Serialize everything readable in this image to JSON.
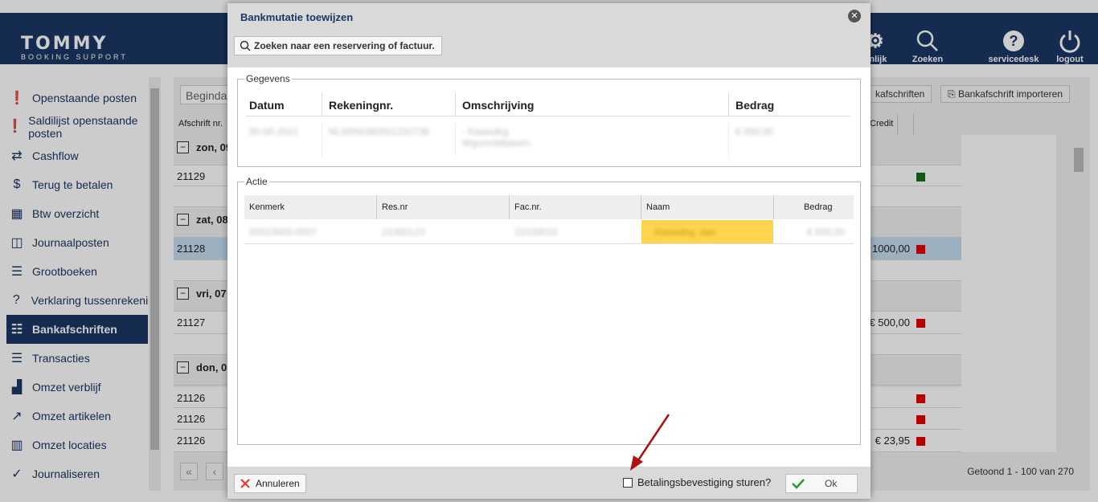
{
  "header": {
    "logo_main": "TOMMY",
    "logo_sub": "BOOKING SUPPORT",
    "buttons": [
      {
        "label": "onlijk",
        "icon": "gear-icon"
      },
      {
        "label": "Zoeken",
        "icon": "search-icon"
      },
      {
        "label": "servicedesk",
        "icon": "help-icon"
      },
      {
        "label": "logout",
        "icon": "power-icon"
      }
    ]
  },
  "sidebar": {
    "items": [
      {
        "label": "Openstaande posten"
      },
      {
        "label": "Saldilijst openstaande posten"
      },
      {
        "label": "Cashflow"
      },
      {
        "label": "Terug te betalen"
      },
      {
        "label": "Btw overzicht"
      },
      {
        "label": "Journaalposten"
      },
      {
        "label": "Grootboeken"
      },
      {
        "label": "Verklaring tussenrekenin"
      },
      {
        "label": "Bankafschriften"
      },
      {
        "label": "Transacties"
      },
      {
        "label": "Omzet verblijf"
      },
      {
        "label": "Omzet artikelen"
      },
      {
        "label": "Omzet locaties"
      },
      {
        "label": "Journaliseren"
      }
    ],
    "active": "Bankafschriften"
  },
  "main": {
    "begindatum_placeholder": "Begindat",
    "btn_bankafschriften": "kafschriften",
    "btn_import": "Bankafschrift importeren",
    "col_afschrift": "Afschrift nr.",
    "col_credit": "Credit",
    "groups": [
      {
        "label": "zon, 09",
        "rows": [
          {
            "nr": "21129",
            "credit": "",
            "status": "green"
          }
        ]
      },
      {
        "label": "zat, 08",
        "rows": [
          {
            "nr": "21128",
            "credit": "1000,00",
            "status": "red"
          }
        ]
      },
      {
        "label": "vri, 07",
        "rows": [
          {
            "nr": "21127",
            "credit": "€ 500,00",
            "status": "red"
          }
        ]
      },
      {
        "label": "don, 0",
        "rows": [
          {
            "nr": "21126",
            "credit": "",
            "status": "red"
          },
          {
            "nr": "21126",
            "credit": "",
            "status": "red"
          },
          {
            "nr": "21126",
            "credit": "€ 23,95",
            "status": "red"
          }
        ]
      }
    ],
    "pager_first": "«",
    "pager_prev": "‹",
    "getoond": "Getoond 1 - 100 van 270"
  },
  "modal": {
    "title": "Bankmutatie toewijzen",
    "search_label": "Zoeken naar een reservering of factuur.",
    "gegevens": {
      "legend": "Gegevens",
      "headers": [
        "Datum",
        "Rekeningnr.",
        "Omschrijving",
        "Bedrag"
      ],
      "row": [
        "00-00-2021",
        "NL00INGB0001232736",
        "- Klaasdhg Wgcmcblitaiven",
        "€ 000,00"
      ]
    },
    "actie": {
      "legend": "Actie",
      "headers": [
        "Kenmerk",
        "Res.nr",
        "Fac.nr.",
        "Naam",
        "Bedrag"
      ],
      "row": [
        "00010000-0007",
        "21000123",
        "22100010",
        "Klaasdhg, dan",
        "€ 000,00"
      ]
    },
    "cancel_label": "Annuleren",
    "checkbox_label": "Betalingsbevestiging sturen?",
    "ok_label": "Ok"
  },
  "colors": {
    "brand": "#1c3664",
    "highlight": "#ffd54f",
    "red": "#e00000",
    "green": "#1a6e1a",
    "arrow": "#b01010"
  }
}
